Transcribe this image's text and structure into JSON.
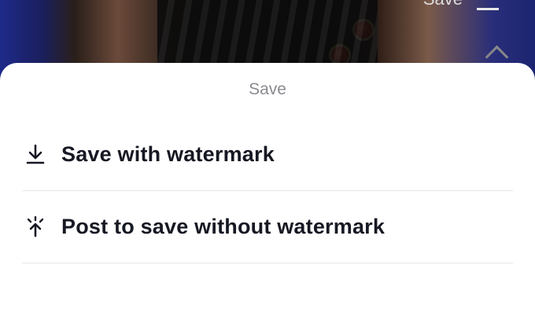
{
  "background": {
    "top_right_label": "Save"
  },
  "sheet": {
    "title": "Save",
    "options": [
      {
        "label": "Save with watermark",
        "icon": "download-icon"
      },
      {
        "label": "Post to save without watermark",
        "icon": "post-sparkle-icon"
      }
    ]
  },
  "colors": {
    "sheet_bg": "#ffffff",
    "title_text": "#8a8b91",
    "option_text": "#161823",
    "divider": "#e6e6e6"
  }
}
